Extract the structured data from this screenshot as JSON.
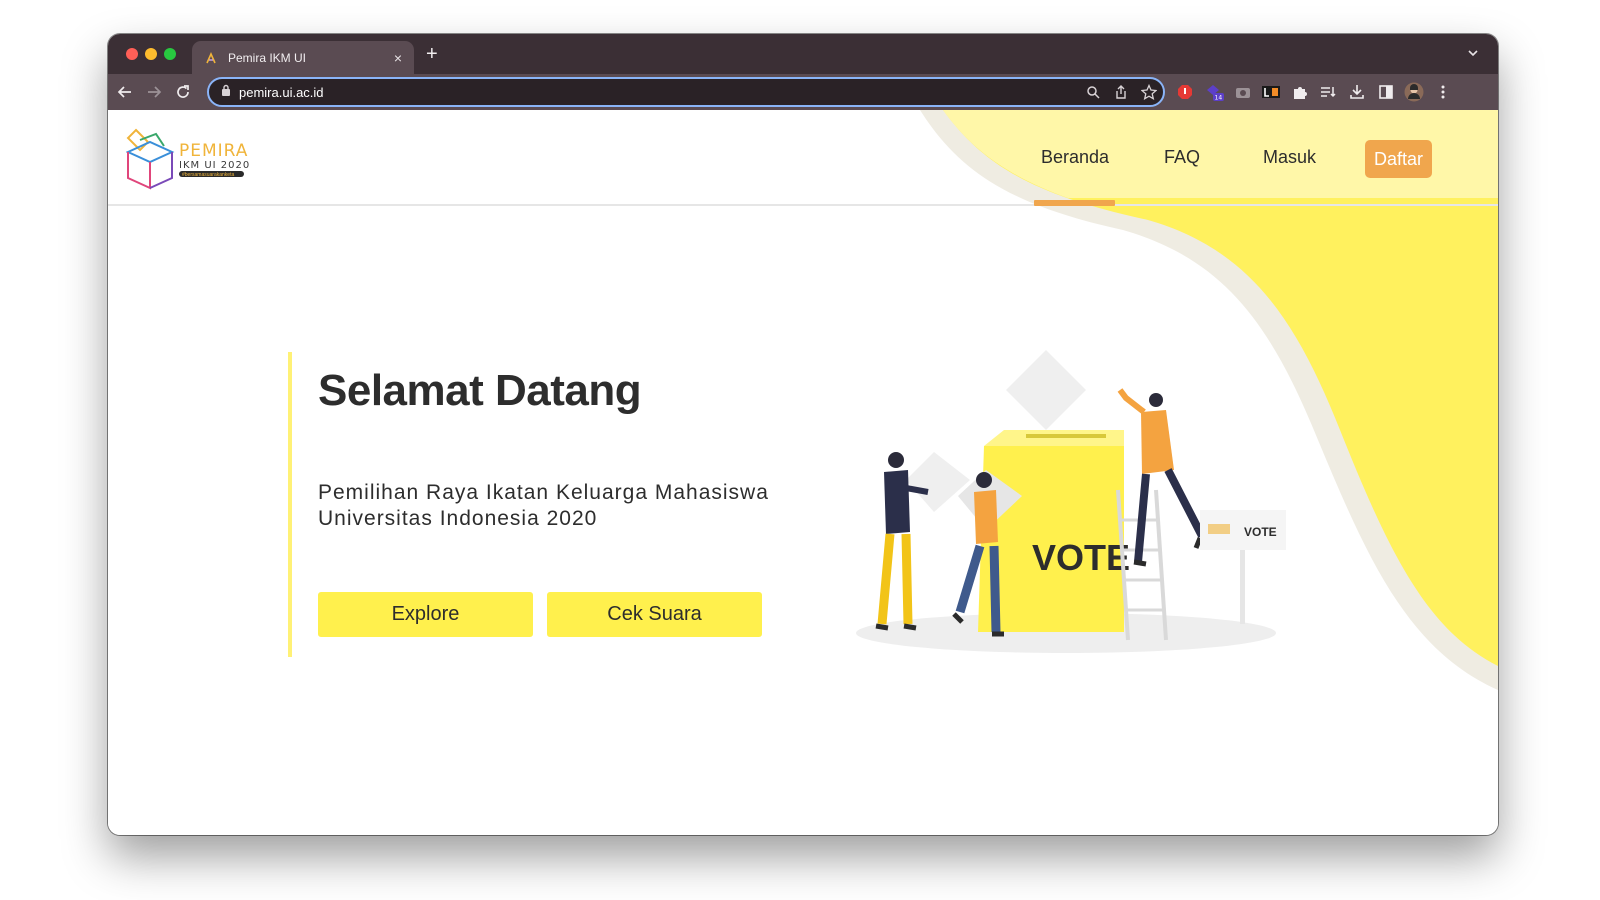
{
  "browser": {
    "tab_title": "Pemira IKM UI",
    "tab_close": "×",
    "new_tab": "+",
    "url": "pemira.ui.ac.id",
    "extension_badge": "14"
  },
  "site": {
    "logo": {
      "main": "PEMIRA",
      "sub": "IKM  UI  2020",
      "tagline": "#bersamasuarakanketa"
    },
    "nav": {
      "items": [
        {
          "label": "Beranda",
          "active": true
        },
        {
          "label": "FAQ",
          "active": false
        },
        {
          "label": "Masuk",
          "active": false
        }
      ],
      "cta": "Daftar"
    }
  },
  "hero": {
    "title": "Selamat Datang",
    "subtitle": "Pemilihan Raya Ikatan Keluarga Mahasiswa Universitas Indonesia 2020",
    "buttons": [
      "Explore",
      "Cek Suara"
    ]
  },
  "illustration": {
    "ballot_label": "VOTE",
    "sign_label": "VOTE"
  },
  "colors": {
    "accent_yellow": "#fff04d",
    "accent_orange": "#f0a64d",
    "text": "#2d2d2d",
    "omnibox_focus": "#8ab4f8"
  },
  "icons": [
    "back-arrow-icon",
    "forward-arrow-icon",
    "reload-icon",
    "lock-icon",
    "zoom-icon",
    "share-icon",
    "star-icon",
    "puzzle-icon",
    "download-icon",
    "kebab-menu-icon"
  ]
}
